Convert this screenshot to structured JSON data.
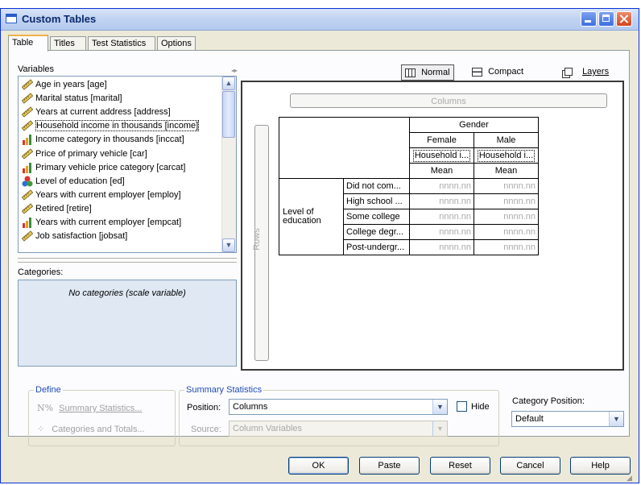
{
  "window": {
    "title": "Custom Tables"
  },
  "tabs": [
    {
      "label": "Table"
    },
    {
      "label": "Titles"
    },
    {
      "label": "Test Statistics"
    },
    {
      "label": "Options"
    }
  ],
  "variables": {
    "label": "Variables",
    "items": [
      {
        "label": "Age in years [age]",
        "icon": "scale-ruler-icon"
      },
      {
        "label": "Marital status [marital]",
        "icon": "scale-ruler-icon"
      },
      {
        "label": "Years at current address [address]",
        "icon": "scale-ruler-icon"
      },
      {
        "label": "Household income in thousands [income]",
        "icon": "scale-ruler-icon"
      },
      {
        "label": "Income category in thousands [inccat]",
        "icon": "ordinal-bars-icon"
      },
      {
        "label": "Price of primary vehicle [car]",
        "icon": "scale-ruler-icon"
      },
      {
        "label": "Primary vehicle price category [carcat]",
        "icon": "ordinal-bars-icon"
      },
      {
        "label": "Level of education [ed]",
        "icon": "nominal-circles-icon"
      },
      {
        "label": "Years with current employer [employ]",
        "icon": "scale-ruler-icon"
      },
      {
        "label": "Retired [retire]",
        "icon": "scale-ruler-icon"
      },
      {
        "label": "Years with current employer [empcat]",
        "icon": "ordinal-bars-icon"
      },
      {
        "label": "Job satisfaction [jobsat]",
        "icon": "scale-ruler-icon"
      }
    ]
  },
  "categories": {
    "label": "Categories:",
    "message": "No categories (scale variable)"
  },
  "view": {
    "normal": "Normal",
    "compact": "Compact",
    "layers": "Layers"
  },
  "drop_zones": {
    "columns": "Columns",
    "rows": "Rows"
  },
  "table": {
    "col_header": "Gender",
    "col_categories": [
      "Female",
      "Male"
    ],
    "summary_var": [
      "Household i...",
      "Household i..."
    ],
    "stat": [
      "Mean",
      "Mean"
    ],
    "row_header": "Level of education",
    "row_categories": [
      "Did not com...",
      "High school ...",
      "Some college",
      "College degr...",
      "Post-undergr..."
    ],
    "placeholder": "nnnn.nn"
  },
  "define": {
    "legend": "Define",
    "summary": "Summary Statistics...",
    "categories": "Categories and Totals..."
  },
  "summary_stats": {
    "legend": "Summary Statistics",
    "position_label": "Position:",
    "position_value": "Columns",
    "hide_label": "Hide",
    "source_label": "Source:",
    "source_value": "Column Variables"
  },
  "category_position": {
    "label": "Category Position:",
    "value": "Default"
  },
  "buttons": {
    "ok": "OK",
    "paste": "Paste",
    "reset": "Reset",
    "cancel": "Cancel",
    "help": "Help"
  },
  "colors": {
    "titlebar": "#c2d4f2",
    "accent": "#f0b24a",
    "panel": "#ece9d8"
  }
}
